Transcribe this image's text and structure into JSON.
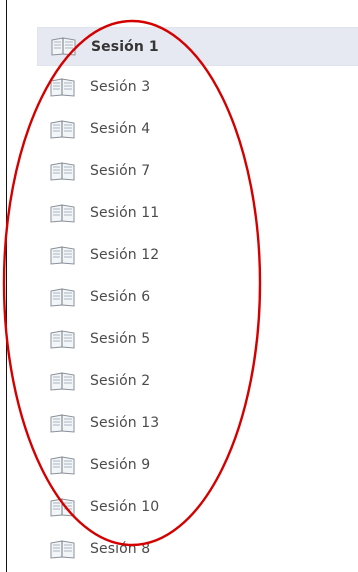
{
  "sessions": [
    {
      "label": "Sesión 1",
      "selected": true
    },
    {
      "label": "Sesión 3"
    },
    {
      "label": "Sesión 4"
    },
    {
      "label": "Sesión 7"
    },
    {
      "label": "Sesión 11"
    },
    {
      "label": "Sesión 12"
    },
    {
      "label": "Sesión 6"
    },
    {
      "label": "Sesión 5"
    },
    {
      "label": "Sesión 2"
    },
    {
      "label": "Sesión 13"
    },
    {
      "label": "Sesión 9"
    },
    {
      "label": "Sesión 10"
    },
    {
      "label": "Sesión 8"
    }
  ],
  "icons": {
    "session_item": "book-icon"
  },
  "colors": {
    "annotation_stroke": "#d40000",
    "selected_background": "#e6e9f2",
    "text": "#4b4b4b"
  }
}
